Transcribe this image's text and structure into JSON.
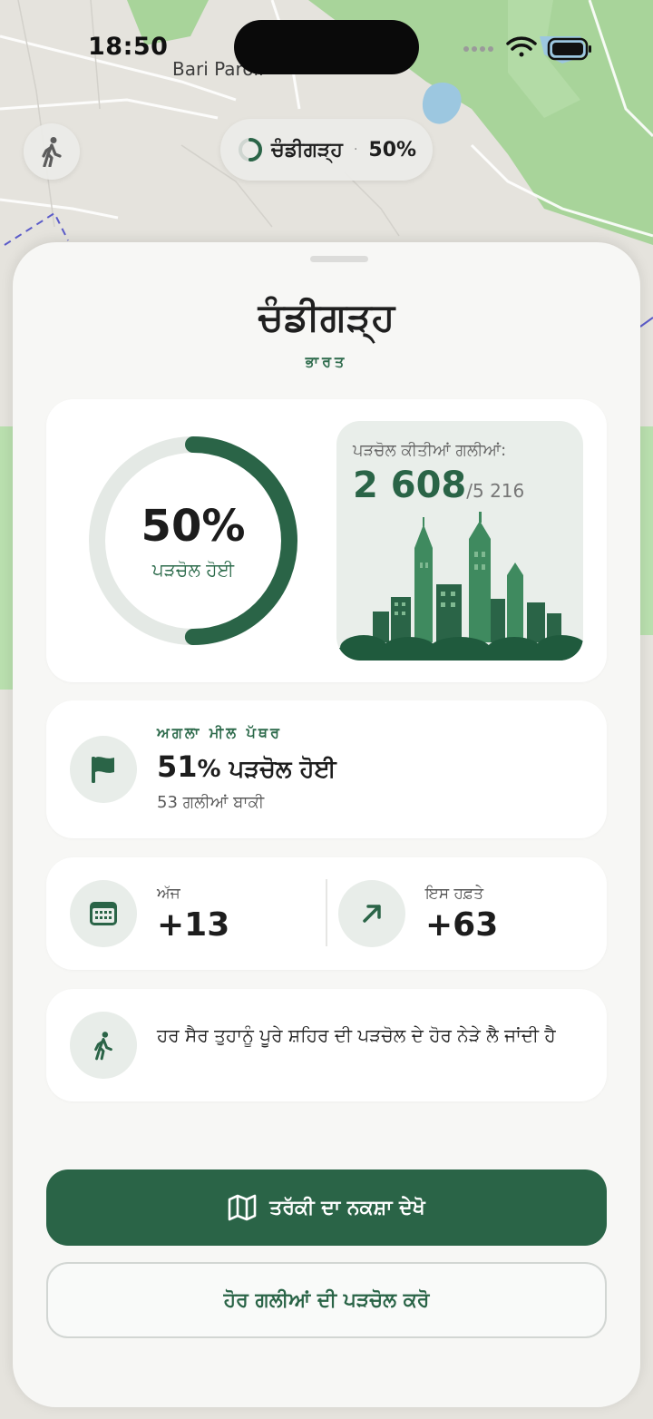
{
  "status_bar": {
    "time": "18:50"
  },
  "map": {
    "place_label": "Bari Paroli"
  },
  "top_pill": {
    "city": "ਚੰਡੀਗੜ੍ਹ",
    "separator": "·",
    "percent": "50%"
  },
  "sheet": {
    "city": "ਚੰਡੀਗੜ੍ਹ",
    "country": "ਭਾਰਤ",
    "progress": {
      "percent_text": "50%",
      "percent_value": 0.5,
      "percent_caption": "ਪੜਚੋਲ ਹੋਈ",
      "streets_label": "ਪੜਚੋਲ ਕੀਤੀਆਂ ਗਲੀਆਂ:",
      "streets_explored": "2 608",
      "streets_total": "/5 216"
    },
    "milestone": {
      "overline": "ਅਗਲਾ ਮੀਲ ਪੱਥਰ",
      "percent": "51",
      "percent_suffix": "% ਪੜਚੋਲ ਹੋਈ",
      "remaining": "53 ਗਲੀਆਂ ਬਾਕੀ"
    },
    "stats": {
      "today_label": "ਅੱਜ",
      "today_value": "+13",
      "week_label": "ਇਸ ਹਫ਼ਤੇ",
      "week_value": "+63"
    },
    "tip": {
      "text": "ਹਰ ਸੈਰ ਤੁਹਾਨੂੰ ਪੂਰੇ ਸ਼ਹਿਰ ਦੀ ਪੜਚੋਲ ਦੇ ਹੋਰ ਨੇੜੇ ਲੈ ਜਾਂਦੀ ਹੈ"
    },
    "buttons": {
      "primary": "ਤਰੱਕੀ ਦਾ ਨਕਸ਼ਾ ਦੇਖੋ",
      "secondary": "ਹੋਰ ਗਲੀਆਂ ਦੀ ਪੜਚੋਲ ਕਰੋ"
    }
  },
  "colors": {
    "accent": "#2a6447",
    "ring_track": "#e4e9e5",
    "sheet_bg": "#f7f7f5",
    "card_bg": "#ffffff"
  },
  "icons": {
    "walk_button": "walking-person-icon",
    "loading": "progress-spinner-icon",
    "milestone": "flag-icon",
    "today": "calendar-icon",
    "week": "arrow-up-right-icon",
    "tip": "walking-person-icon",
    "map": "map-icon"
  }
}
